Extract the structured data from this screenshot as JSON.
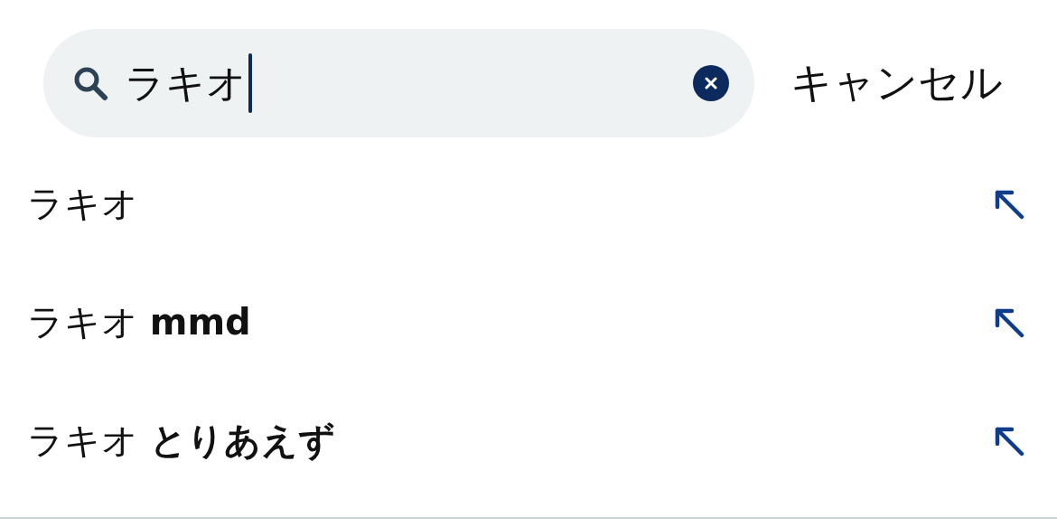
{
  "search": {
    "value": "ラキオ",
    "cancel": "キャンセル"
  },
  "suggestions": [
    {
      "text": "ラキオ"
    },
    {
      "text": "ラキオ **mmd**"
    },
    {
      "text": "ラキオ **とりあえず**"
    }
  ]
}
